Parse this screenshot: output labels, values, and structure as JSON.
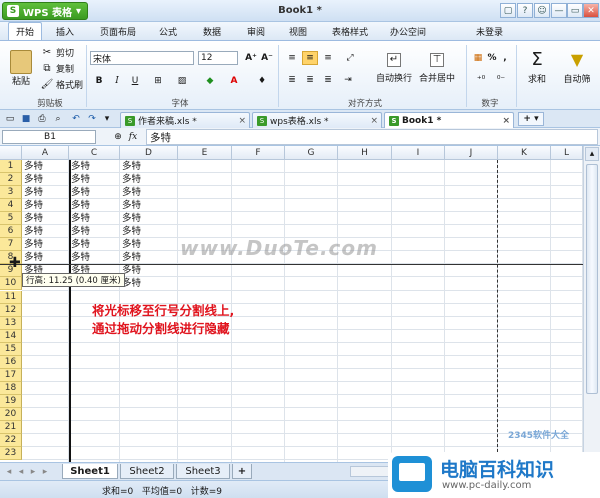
{
  "app": {
    "name": "WPS 表格",
    "title": "Book1 *"
  },
  "window_buttons": [
    "▢",
    "?",
    "☺",
    "—",
    "▭",
    "✕"
  ],
  "menu": {
    "items": [
      "开始",
      "插入",
      "页面布局",
      "公式",
      "数据",
      "审阅",
      "视图",
      "表格样式",
      "办公空间"
    ],
    "active": "开始",
    "login": "未登录"
  },
  "ribbon": {
    "clipboard": {
      "paste": "粘贴",
      "cut": "剪切",
      "copy": "复制",
      "format_painter": "格式刷",
      "label": "剪贴板"
    },
    "font": {
      "name": "宋体",
      "size": "12",
      "grow": "A⁺",
      "shrink": "A⁻",
      "bold": "B",
      "italic": "I",
      "underline": "U",
      "label": "字体"
    },
    "alignment": {
      "wrap": "自动换行",
      "merge": "合并居中",
      "label": "对齐方式"
    },
    "number": {
      "percent": "%",
      "comma": ",",
      "label": "数字"
    },
    "editing": {
      "sum": "求和",
      "filter": "自动筛"
    }
  },
  "doc_tabs": [
    {
      "label": "作者来稿.xls *",
      "close": "×"
    },
    {
      "label": "wps表格.xls *",
      "close": "×"
    },
    {
      "label": "Book1 *",
      "close": "×"
    }
  ],
  "formula_bar": {
    "cell_ref": "B1",
    "fx": "fx",
    "value": "多特"
  },
  "sheet": {
    "columns": [
      "A",
      "C",
      "D",
      "E",
      "F",
      "G",
      "H",
      "I",
      "J",
      "K",
      "L"
    ],
    "rows": [
      "1",
      "2",
      "3",
      "4",
      "5",
      "6",
      "7",
      "8",
      "9",
      "10",
      "11",
      "12",
      "13",
      "14",
      "15",
      "16",
      "17",
      "18",
      "19",
      "20",
      "21",
      "22",
      "23"
    ],
    "cell_text": "多特",
    "filled_rows_acd": 9,
    "row10_d_only": true
  },
  "tooltip": "行高: 11.25 (0.40 厘米)",
  "annotation": [
    "将光标移至行号分割线上,",
    "通过拖动分割线进行隐藏"
  ],
  "watermark": "www.DuoTe.com",
  "sheet_tabs": [
    "Sheet1",
    "Sheet2",
    "Sheet3",
    "+"
  ],
  "status": "求和=0   平均值=0   计数=9",
  "brand": {
    "name": "电脑百科知识",
    "url": "www.pc-daily.com",
    "logo": "2345软件大全"
  },
  "colors": {
    "accent_green": "#3b9b22",
    "row_header": "#fbe89a",
    "annotation_red": "#e0141e",
    "brand_blue": "#1e78c8"
  }
}
